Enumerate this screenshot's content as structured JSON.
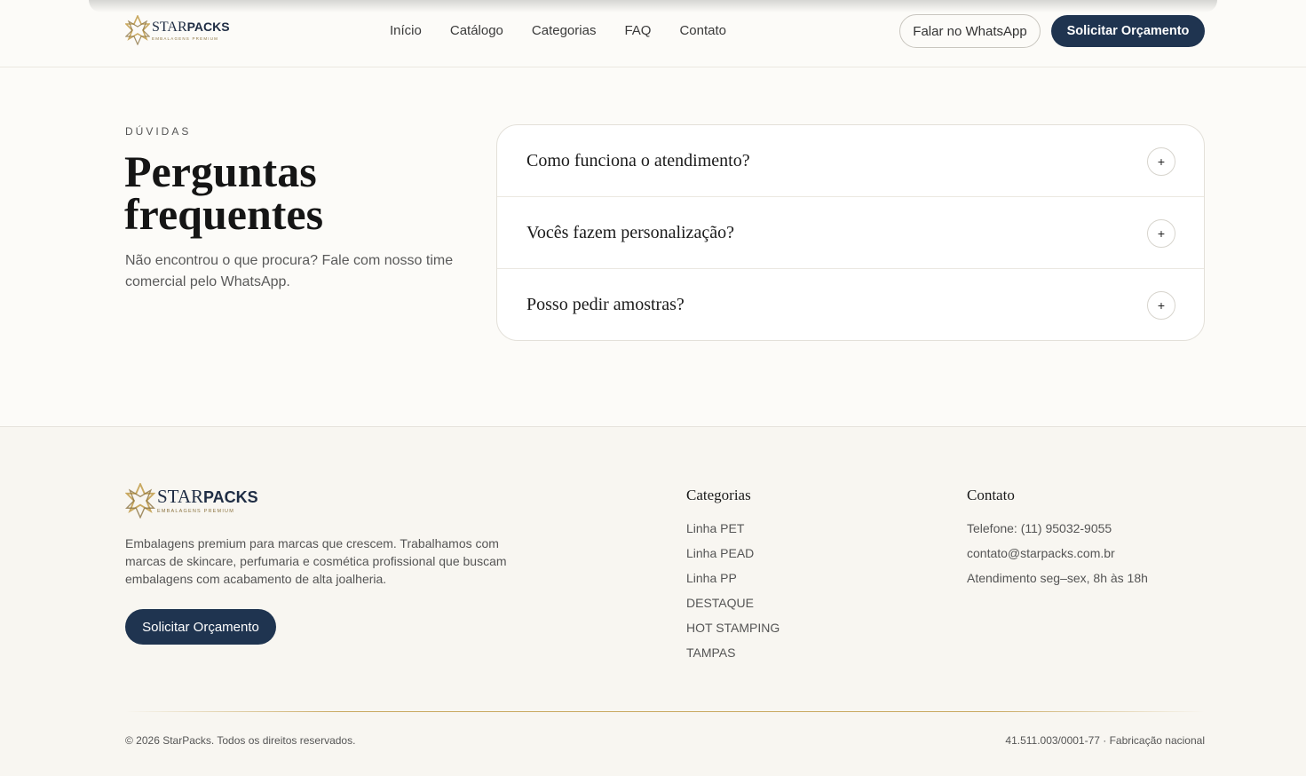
{
  "brand": {
    "name_left": "STAR",
    "name_right": "PACKS",
    "tagline": "EMBALAGENS PREMIUM",
    "accent_gold": "#c9a961",
    "navy": "#1f3450"
  },
  "header": {
    "nav": [
      "Início",
      "Catálogo",
      "Categorias",
      "FAQ",
      "Contato"
    ],
    "whatsapp_button": "Falar no WhatsApp",
    "quote_button": "Solicitar Orçamento"
  },
  "faq": {
    "eyebrow": "DÚVIDAS",
    "title": "Perguntas frequentes",
    "subtitle": "Não encontrou o que procura? Fale com nosso time comercial pelo WhatsApp.",
    "items": [
      {
        "question": "Como funciona o atendimento?",
        "icon": "+"
      },
      {
        "question": "Vocês fazem personalização?",
        "icon": "+"
      },
      {
        "question": "Posso pedir amostras?",
        "icon": "+"
      }
    ]
  },
  "footer": {
    "description": "Embalagens premium para marcas que crescem. Trabalhamos com marcas de skincare, perfumaria e cosmética profissional que buscam embalagens com acabamento de alta joalheria.",
    "quote_button": "Solicitar Orçamento",
    "categories_title": "Categorias",
    "categories": [
      "Linha PET",
      "Linha PEAD",
      "Linha PP",
      "DESTAQUE",
      "HOT STAMPING",
      "TAMPAS"
    ],
    "contact_title": "Contato",
    "contact": [
      "Telefone: (11) 95032-9055",
      "contato@starpacks.com.br",
      "Atendimento seg–sex, 8h às 18h"
    ],
    "copyright": "© 2026 StarPacks. Todos os direitos reservados.",
    "legal": "41.511.003/0001-77 · Fabricação nacional"
  }
}
